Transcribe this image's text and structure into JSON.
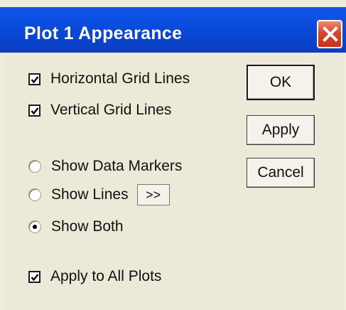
{
  "dialog": {
    "title": "Plot 1 Appearance",
    "close_icon": "close-icon"
  },
  "options": {
    "horizontal_grid": {
      "label": "Horizontal Grid Lines",
      "checked": true
    },
    "vertical_grid": {
      "label": "Vertical Grid Lines",
      "checked": true
    },
    "show_data_markers": {
      "label": "Show Data Markers",
      "selected": false
    },
    "show_lines": {
      "label": "Show Lines",
      "selected": false,
      "more_label": ">>"
    },
    "show_both": {
      "label": "Show Both",
      "selected": true
    },
    "apply_all": {
      "label": "Apply to All Plots",
      "checked": true
    }
  },
  "buttons": {
    "ok": "OK",
    "apply": "Apply",
    "cancel": "Cancel"
  }
}
